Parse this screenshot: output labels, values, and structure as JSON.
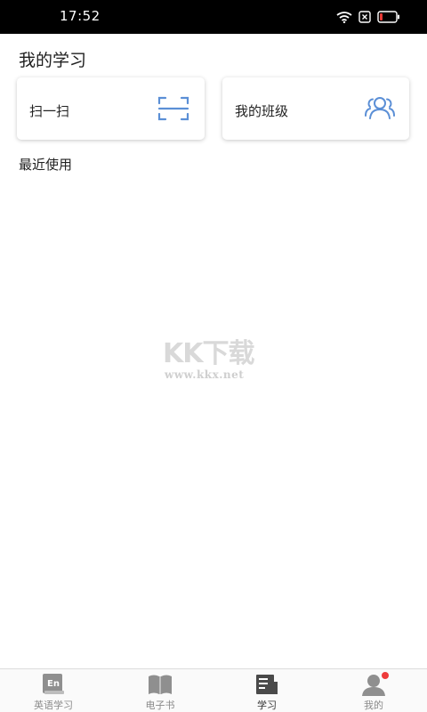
{
  "status_bar": {
    "time": "17:52",
    "icons": [
      "wifi-icon",
      "sim-off-icon",
      "battery-low-icon"
    ],
    "battery_color": "#e53935"
  },
  "page_title": "我的学习",
  "cards": {
    "scan": {
      "label": "扫一扫",
      "icon": "scan-icon"
    },
    "my_class": {
      "label": "我的班级",
      "icon": "group-icon"
    }
  },
  "accent_color": "#5b8fd6",
  "recent": {
    "title": "最近使用"
  },
  "watermark": {
    "main": "KK下载",
    "sub": "www.kkx.net"
  },
  "tabbar": {
    "items": [
      {
        "label": "英语学习",
        "icon": "en-book-icon",
        "active": false
      },
      {
        "label": "电子书",
        "icon": "open-book-icon",
        "active": false
      },
      {
        "label": "学习",
        "icon": "study-doc-icon",
        "active": true
      },
      {
        "label": "我的",
        "icon": "user-icon",
        "active": false,
        "badge": true
      }
    ],
    "icon_text_en": "En"
  }
}
